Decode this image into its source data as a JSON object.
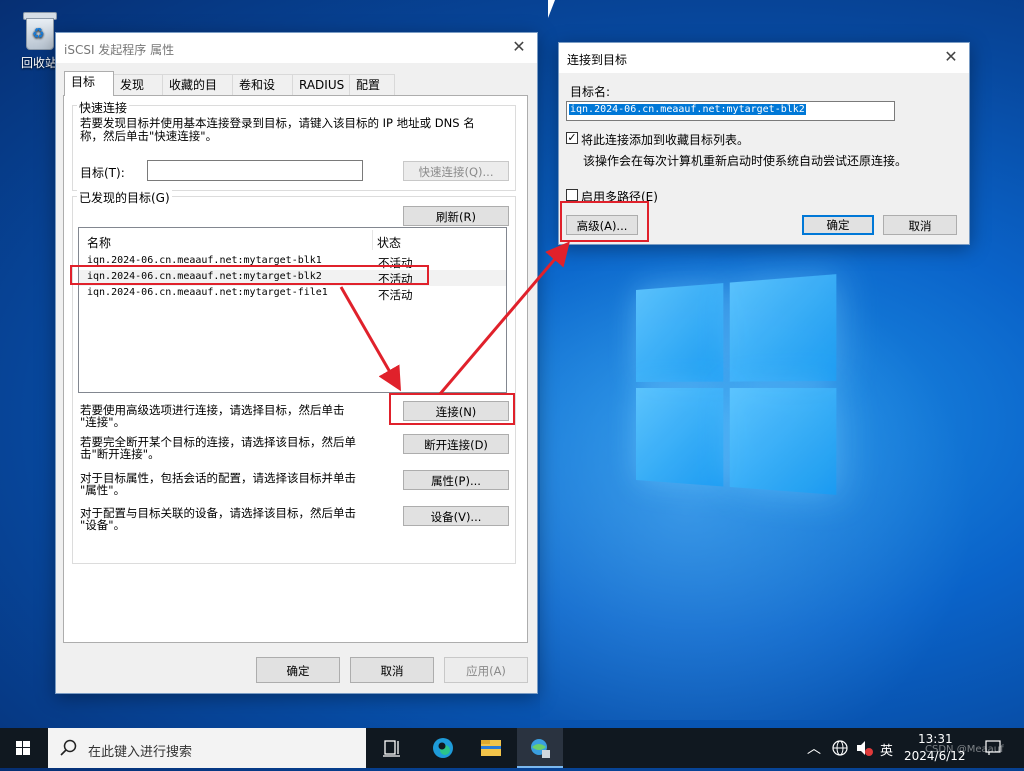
{
  "desktop": {
    "recycle_bin_label": "回收站"
  },
  "iscsi_dialog": {
    "title": "iSCSI 发起程序 属性",
    "tabs": [
      "目标",
      "发现",
      "收藏的目标",
      "卷和设备",
      "RADIUS",
      "配置"
    ],
    "quick_connect": {
      "group_title": "快速连接",
      "description_line1": "若要发现目标并使用基本连接登录到目标，请键入该目标的 IP 地址或 DNS 名",
      "description_line2": "称，然后单击\"快速连接\"。",
      "target_label": "目标(T):",
      "target_value": "",
      "quick_connect_button": "快速连接(Q)..."
    },
    "discovered": {
      "group_title": "已发现的目标(G)",
      "refresh_button": "刷新(R)",
      "columns": [
        "名称",
        "状态"
      ],
      "rows": [
        {
          "name": "iqn.2024-06.cn.meaauf.net:mytarget-blk1",
          "status": "不活动"
        },
        {
          "name": "iqn.2024-06.cn.meaauf.net:mytarget-blk2",
          "status": "不活动"
        },
        {
          "name": "iqn.2024-06.cn.meaauf.net:mytarget-file1",
          "status": "不活动"
        }
      ]
    },
    "actions": [
      {
        "line1": "若要使用高级选项进行连接，请选择目标，然后单击",
        "line2": "\"连接\"。",
        "button": "连接(N)"
      },
      {
        "line1": "若要完全断开某个目标的连接，请选择该目标，然后单",
        "line2": "击\"断开连接\"。",
        "button": "断开连接(D)"
      },
      {
        "line1": "对于目标属性，包括会话的配置，请选择该目标并单击",
        "line2": "\"属性\"。",
        "button": "属性(P)..."
      },
      {
        "line1": "对于配置与目标关联的设备，请选择该目标，然后单击",
        "line2": "\"设备\"。",
        "button": "设备(V)..."
      }
    ],
    "ok_button": "确定",
    "cancel_button": "取消",
    "apply_button": "应用(A)"
  },
  "connect_dialog": {
    "title": "连接到目标",
    "target_name_label": "目标名:",
    "target_name_value": "iqn.2024-06.cn.meaauf.net:mytarget-blk2",
    "add_favorites_label": "将此连接添加到收藏目标列表。",
    "add_favorites_checked": true,
    "add_favorites_note": "该操作会在每次计算机重新启动时使系统自动尝试还原连接。",
    "multipath_label": "启用多路径(E)",
    "multipath_checked": false,
    "advanced_button": "高级(A)...",
    "ok_button": "确定",
    "cancel_button": "取消"
  },
  "taskbar": {
    "search_placeholder": "在此键入进行搜索",
    "ime_label": "英",
    "time": "13:31",
    "date": "2024/6/12",
    "watermark": "CSDN @Meaauf"
  },
  "colors": {
    "annotation_red": "#e0212b",
    "accent_blue": "#0078d7",
    "selection_blue": "#0078d7"
  }
}
